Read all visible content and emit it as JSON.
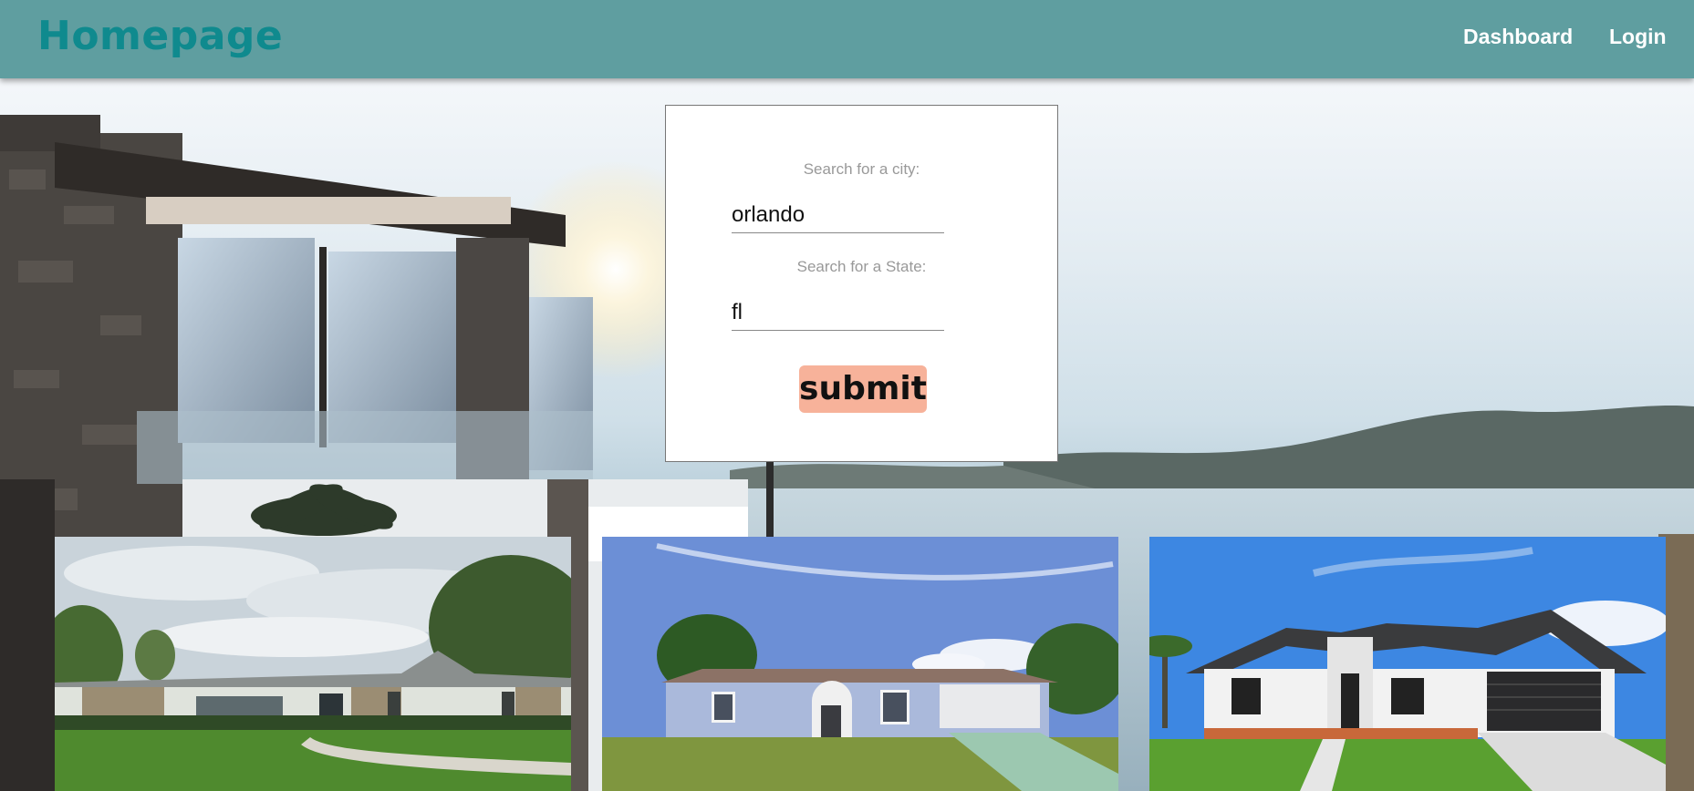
{
  "navbar": {
    "brand": "Homepage",
    "links": [
      {
        "label": "Dashboard"
      },
      {
        "label": "Login"
      }
    ]
  },
  "search": {
    "city_label": "Search for a city:",
    "city_value": "orlando",
    "state_label": "Search for a State:",
    "state_value": "fl",
    "submit_label": "submit"
  },
  "listings": [
    {
      "image": "ranch-house-photo"
    },
    {
      "image": "blue-house-photo"
    },
    {
      "image": "white-modern-house-photo"
    }
  ],
  "colors": {
    "navbar": "#5f9ea0",
    "brand": "#0f8a8e",
    "submit": "#f7b29a"
  }
}
